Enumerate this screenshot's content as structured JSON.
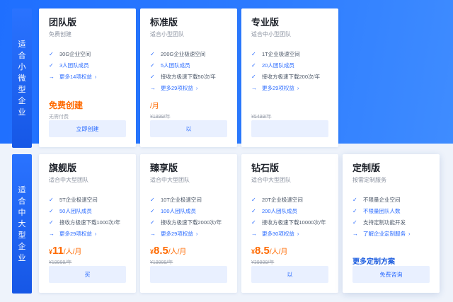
{
  "tiers": {
    "top": "适合小微型企业",
    "bottom": "适合中大型企业"
  },
  "plans": [
    {
      "title": "团队版",
      "subtitle": "免费创建",
      "features": [
        "30G企业空间",
        "3人团队成员"
      ],
      "more": "更多14项权益",
      "price": "免费创建",
      "price_note": "无需付费",
      "button": "立即创建"
    },
    {
      "title": "标准版",
      "subtitle": "适合小型团队",
      "features": [
        "200G企业极速空间",
        "5人团队成员",
        "接收方极速下载50次/年"
      ],
      "more": "更多29项权益",
      "price_unit": "/月",
      "price_old": "¥1899/年",
      "button": "以"
    },
    {
      "title": "专业版",
      "subtitle": "适合中小型团队",
      "features": [
        "1T企业极速空间",
        "20人团队成员",
        "接收方极速下载200次/年"
      ],
      "more": "更多29项权益",
      "price_old": "¥5499/年",
      "button": ""
    },
    {
      "title": "旗舰版",
      "subtitle": "适合中大型团队",
      "features": [
        "5T企业极速空间",
        "50人团队成员",
        "接收方极速下载1000次/年"
      ],
      "more": "更多29项权益",
      "price_cur": "¥",
      "price_num": "11",
      "price_unit": "/人/月",
      "price_old": "¥19999/年",
      "button": "买"
    },
    {
      "title": "臻享版",
      "subtitle": "适合中大型团队",
      "features": [
        "10T企业极速空间",
        "100人团队成员",
        "接收方极速下载2000次/年"
      ],
      "more": "更多29项权益",
      "price_cur": "¥",
      "price_num": "8.5",
      "price_unit": "/人/月",
      "price_old": "¥19999/年",
      "button": ""
    },
    {
      "title": "钻石版",
      "subtitle": "适合中大型团队",
      "features": [
        "20T企业极速空间",
        "200人团队成员",
        "接收方极速下载10000次/年"
      ],
      "more": "更多30项权益",
      "price_cur": "¥",
      "price_num": "8.5",
      "price_unit": "/人/月",
      "price_old": "¥39999/年",
      "button": "以"
    },
    {
      "title": "定制版",
      "subtitle": "按需定制服务",
      "features": [
        "不限量企业空间",
        "不限量团队人数",
        "支持定制功能开发"
      ],
      "more": "了解企业定制服务",
      "custom_more": "更多定制方案",
      "button": "免费咨询"
    }
  ],
  "colors": {
    "accent": "#2a6bff",
    "price": "#ff6a00",
    "band": "#1f6fff"
  }
}
